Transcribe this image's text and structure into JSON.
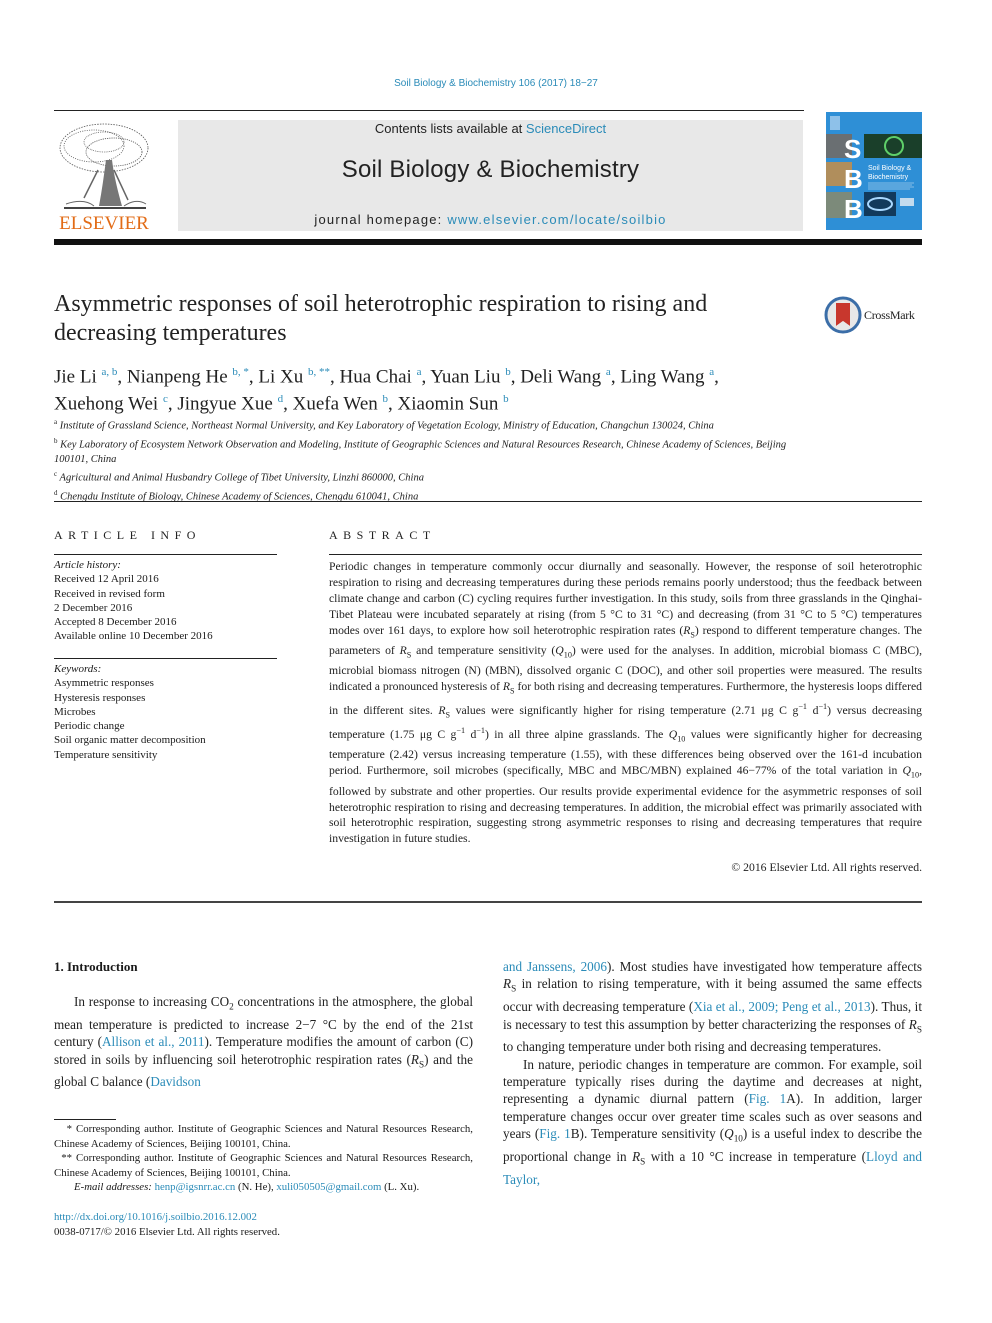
{
  "citation": "Soil Biology & Biochemistry 106 (2017) 18−27",
  "journal_header": {
    "contents_prefix": "Contents lists available at ",
    "contents_link": "ScienceDirect",
    "journal_name": "Soil Biology & Biochemistry",
    "homepage_prefix": "journal homepage: ",
    "homepage_link": "www.elsevier.com/locate/soilbio",
    "publisher_logo_text": "ELSEVIER",
    "cover_letters": [
      "S",
      "B",
      "B"
    ],
    "cover_title_1": "Soil Biology &",
    "cover_title_2": "Biochemistry"
  },
  "article": {
    "title": "Asymmetric responses of soil heterotrophic respiration to rising and decreasing temperatures",
    "crossmark_label": "CrossMark",
    "authors": [
      {
        "name": "Jie Li",
        "aff": "a, b",
        "sep": ", "
      },
      {
        "name": "Nianpeng He",
        "aff": "b, *",
        "sep": ", "
      },
      {
        "name": "Li Xu",
        "aff": "b, **",
        "sep": ", "
      },
      {
        "name": "Hua Chai",
        "aff": "a",
        "sep": ", "
      },
      {
        "name": "Yuan Liu",
        "aff": "b",
        "sep": ", "
      },
      {
        "name": "Deli Wang",
        "aff": "a",
        "sep": ", "
      },
      {
        "name": "Ling Wang",
        "aff": "a",
        "sep": ","
      },
      {
        "name": "Xuehong Wei",
        "aff": "c",
        "sep": ", "
      },
      {
        "name": "Jingyue Xue",
        "aff": "d",
        "sep": ", "
      },
      {
        "name": "Xuefa Wen",
        "aff": "b",
        "sep": ", "
      },
      {
        "name": "Xiaomin Sun",
        "aff": "b",
        "sep": ""
      }
    ],
    "affiliations": [
      {
        "key": "a",
        "text": "Institute of Grassland Science, Northeast Normal University, and Key Laboratory of Vegetation Ecology, Ministry of Education, Changchun 130024, China"
      },
      {
        "key": "b",
        "text": "Key Laboratory of Ecosystem Network Observation and Modeling, Institute of Geographic Sciences and Natural Resources Research, Chinese Academy of Sciences, Beijing 100101, China"
      },
      {
        "key": "c",
        "text": "Agricultural and Animal Husbandry College of Tibet University, Linzhi 860000, China"
      },
      {
        "key": "d",
        "text": "Chengdu Institute of Biology, Chinese Academy of Sciences, Chengdu 610041, China"
      }
    ]
  },
  "article_info": {
    "heading": "ARTICLE INFO",
    "history_label": "Article history:",
    "history": [
      "Received 12 April 2016",
      "Received in revised form",
      "2 December 2016",
      "Accepted 8 December 2016",
      "Available online 10 December 2016"
    ],
    "keywords_label": "Keywords:",
    "keywords": [
      "Asymmetric responses",
      "Hysteresis responses",
      "Microbes",
      "Periodic change",
      "Soil organic matter decomposition",
      "Temperature sensitivity"
    ]
  },
  "abstract": {
    "heading": "ABSTRACT",
    "segments": [
      {
        "t": "Periodic changes in temperature commonly occur diurnally and seasonally. However, the response of soil heterotrophic respiration to rising and decreasing temperatures during these periods remains poorly understood; thus the feedback between climate change and carbon (C) cycling requires further investigation. In this study, soils from three grasslands in the Qinghai-Tibet Plateau were incubated separately at rising (from 5 °C to 31 °C) and decreasing (from 31 °C to 5 °C) temperatures modes over 161 days, to explore how soil heterotrophic respiration rates ("
      },
      {
        "i": "R",
        "sub": "S"
      },
      {
        "t": ") respond to different temperature changes. The parameters of "
      },
      {
        "i": "R",
        "sub": "S"
      },
      {
        "t": " and temperature sensitivity ("
      },
      {
        "i": "Q",
        "sub": "10"
      },
      {
        "t": ") were used for the analyses. In addition, microbial biomass C (MBC), microbial biomass nitrogen (N) (MBN), dissolved organic C (DOC), and other soil properties were measured. The results indicated a pronounced hysteresis of "
      },
      {
        "i": "R",
        "sub": "S"
      },
      {
        "t": " for both rising and decreasing temperatures. Furthermore, the hysteresis loops differed in the different sites. "
      },
      {
        "i": "R",
        "sub": "S"
      },
      {
        "t": " values were significantly higher for rising temperature (2.71 μg C g"
      },
      {
        "sup": "−1"
      },
      {
        "t": " d"
      },
      {
        "sup": "−1"
      },
      {
        "t": ") versus decreasing temperature (1.75 μg C g"
      },
      {
        "sup": "−1"
      },
      {
        "t": " d"
      },
      {
        "sup": "−1"
      },
      {
        "t": ") in all three alpine grasslands. The "
      },
      {
        "i": "Q",
        "sub": "10"
      },
      {
        "t": " values were significantly higher for decreasing temperature (2.42) versus increasing temperature (1.55), with these differences being observed over the 161-d incubation period. Furthermore, soil microbes (specifically, MBC and MBC/MBN) explained 46−77% of the total variation in "
      },
      {
        "i": "Q",
        "sub": "10"
      },
      {
        "t": ", followed by substrate and other properties. Our results provide experimental evidence for the asymmetric responses of soil heterotrophic respiration to rising and decreasing temperatures. In addition, the microbial effect was primarily associated with soil heterotrophic respiration, suggesting strong asymmetric responses to rising and decreasing temperatures that require investigation in future studies."
      }
    ],
    "copyright": "© 2016 Elsevier Ltd. All rights reserved."
  },
  "body": {
    "section_heading": "1.  Introduction",
    "left_paragraph": [
      {
        "t": "In response to increasing CO"
      },
      {
        "sub": "2"
      },
      {
        "t": " concentrations in the atmosphere, the global mean temperature is predicted to increase 2−7 °C by the end of the 21st century ("
      },
      {
        "link": "Allison et al., 2011"
      },
      {
        "t": "). Temperature modifies the amount of carbon (C) stored in soils by influencing soil heterotrophic respiration rates ("
      },
      {
        "i": "R",
        "sub": "S"
      },
      {
        "t": ") and the global C balance ("
      },
      {
        "link": "Davidson"
      }
    ],
    "right_paragraph_1": [
      {
        "link": "and Janssens, 2006"
      },
      {
        "t": "). Most studies have investigated how temperature affects "
      },
      {
        "i": "R",
        "sub": "S"
      },
      {
        "t": " in relation to rising temperature, with it being assumed the same effects occur with decreasing temperature ("
      },
      {
        "link": "Xia et al., 2009; Peng et al., 2013"
      },
      {
        "t": "). Thus, it is necessary to test this assumption by better characterizing the responses of "
      },
      {
        "i": "R",
        "sub": "S"
      },
      {
        "t": " to changing temperature under both rising and decreasing temperatures."
      }
    ],
    "right_paragraph_2": [
      {
        "t": "In nature, periodic changes in temperature are common. For example, soil temperature typically rises during the daytime and decreases at night, representing a dynamic diurnal pattern ("
      },
      {
        "link": "Fig. 1"
      },
      {
        "t": "A). In addition, larger temperature changes occur over greater time scales such as over seasons and years ("
      },
      {
        "link": "Fig. 1"
      },
      {
        "t": "B). Temperature sensitivity ("
      },
      {
        "i": "Q",
        "sub": "10"
      },
      {
        "t": ") is a useful index to describe the proportional change in "
      },
      {
        "i": "R",
        "sub": "S"
      },
      {
        "t": " with a 10 °C increase in temperature ("
      },
      {
        "link": "Lloyd and Taylor,"
      }
    ]
  },
  "footnotes": {
    "corr1_mark": "*",
    "corr1_text": "Corresponding author. Institute of Geographic Sciences and Natural Resources Research, Chinese Academy of Sciences, Beijing 100101, China.",
    "corr2_mark": "**",
    "corr2_text": "Corresponding author. Institute of Geographic Sciences and Natural Resources Research, Chinese Academy of Sciences, Beijing 100101, China.",
    "email_label": "E-mail addresses:",
    "email1": "henp@igsnrr.ac.cn",
    "email1_owner": " (N. He), ",
    "email2": "xuli050505@gmail.com",
    "email2_owner": " (L. Xu).",
    "doi": "http://dx.doi.org/10.1016/j.soilbio.2016.12.002",
    "issn_line": "0038-0717/© 2016 Elsevier Ltd. All rights reserved."
  },
  "colors": {
    "link": "#2a8bb8",
    "elsevier_orange": "#e26b16",
    "header_box": "#e8e8e8",
    "cover_blue": "#2e8fd6",
    "crossmark_red": "#c8372d"
  }
}
